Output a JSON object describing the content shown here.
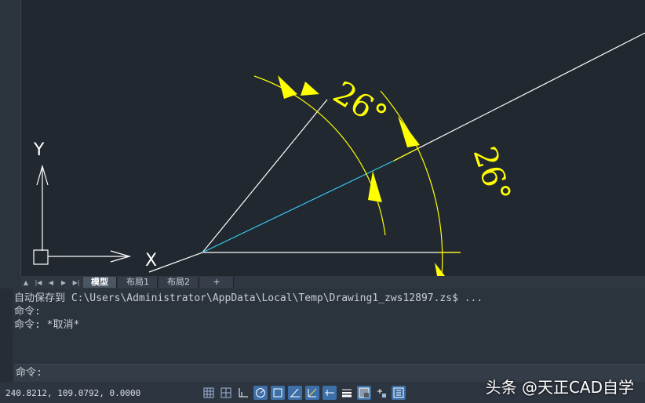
{
  "drawing": {
    "dimension_left": "26°",
    "dimension_right": "26°",
    "ucs_y_label": "Y",
    "ucs_x_label": "X"
  },
  "layout_tabs": {
    "items": [
      {
        "label": "模型",
        "active": true
      },
      {
        "label": "布局1",
        "active": false
      },
      {
        "label": "布局2",
        "active": false
      },
      {
        "label": "+",
        "active": false
      }
    ]
  },
  "command_window": {
    "history": [
      "自动保存到 C:\\Users\\Administrator\\AppData\\Local\\Temp\\Drawing1_zws12897.zs$ ...",
      "命令:",
      "命令: *取消*"
    ],
    "prompt": "命令:"
  },
  "status_bar": {
    "coordinates": "240.8212, 109.0792, 0.0000",
    "tools": [
      {
        "icon": "grid-icon",
        "on": false
      },
      {
        "icon": "snap-grid-icon",
        "on": false
      },
      {
        "icon": "ortho-icon",
        "on": false
      },
      {
        "icon": "polar-icon",
        "on": true
      },
      {
        "icon": "osnap-icon",
        "on": true
      },
      {
        "icon": "otrack-icon",
        "on": true
      },
      {
        "icon": "dynamic-ucs-icon",
        "on": true
      },
      {
        "icon": "dynamic-input-icon",
        "on": true
      },
      {
        "icon": "lineweight-icon",
        "on": false
      },
      {
        "icon": "transparency-icon",
        "on": true
      },
      {
        "icon": "selection-cycling-icon",
        "on": false
      },
      {
        "icon": "annotation-monitor-icon",
        "on": true
      }
    ]
  },
  "watermark": "头条 @天正CAD自学",
  "colors": {
    "canvas": "#212830",
    "dimension": "#ffff00",
    "highlight_line": "#00c8ff",
    "geometry": "#ffffff"
  }
}
